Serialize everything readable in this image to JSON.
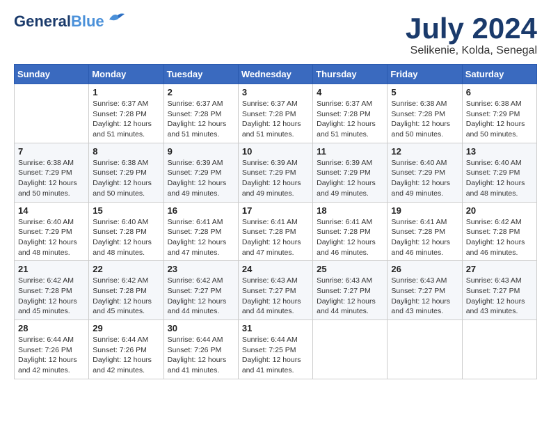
{
  "header": {
    "logo_line1": "General",
    "logo_line2": "Blue",
    "month_title": "July 2024",
    "location": "Selikenie, Kolda, Senegal"
  },
  "days_of_week": [
    "Sunday",
    "Monday",
    "Tuesday",
    "Wednesday",
    "Thursday",
    "Friday",
    "Saturday"
  ],
  "weeks": [
    [
      {
        "day": "",
        "sunrise": "",
        "sunset": "",
        "daylight": ""
      },
      {
        "day": "1",
        "sunrise": "Sunrise: 6:37 AM",
        "sunset": "Sunset: 7:28 PM",
        "daylight": "Daylight: 12 hours and 51 minutes."
      },
      {
        "day": "2",
        "sunrise": "Sunrise: 6:37 AM",
        "sunset": "Sunset: 7:28 PM",
        "daylight": "Daylight: 12 hours and 51 minutes."
      },
      {
        "day": "3",
        "sunrise": "Sunrise: 6:37 AM",
        "sunset": "Sunset: 7:28 PM",
        "daylight": "Daylight: 12 hours and 51 minutes."
      },
      {
        "day": "4",
        "sunrise": "Sunrise: 6:37 AM",
        "sunset": "Sunset: 7:28 PM",
        "daylight": "Daylight: 12 hours and 51 minutes."
      },
      {
        "day": "5",
        "sunrise": "Sunrise: 6:38 AM",
        "sunset": "Sunset: 7:28 PM",
        "daylight": "Daylight: 12 hours and 50 minutes."
      },
      {
        "day": "6",
        "sunrise": "Sunrise: 6:38 AM",
        "sunset": "Sunset: 7:29 PM",
        "daylight": "Daylight: 12 hours and 50 minutes."
      }
    ],
    [
      {
        "day": "7",
        "sunrise": "Sunrise: 6:38 AM",
        "sunset": "Sunset: 7:29 PM",
        "daylight": "Daylight: 12 hours and 50 minutes."
      },
      {
        "day": "8",
        "sunrise": "Sunrise: 6:38 AM",
        "sunset": "Sunset: 7:29 PM",
        "daylight": "Daylight: 12 hours and 50 minutes."
      },
      {
        "day": "9",
        "sunrise": "Sunrise: 6:39 AM",
        "sunset": "Sunset: 7:29 PM",
        "daylight": "Daylight: 12 hours and 49 minutes."
      },
      {
        "day": "10",
        "sunrise": "Sunrise: 6:39 AM",
        "sunset": "Sunset: 7:29 PM",
        "daylight": "Daylight: 12 hours and 49 minutes."
      },
      {
        "day": "11",
        "sunrise": "Sunrise: 6:39 AM",
        "sunset": "Sunset: 7:29 PM",
        "daylight": "Daylight: 12 hours and 49 minutes."
      },
      {
        "day": "12",
        "sunrise": "Sunrise: 6:40 AM",
        "sunset": "Sunset: 7:29 PM",
        "daylight": "Daylight: 12 hours and 49 minutes."
      },
      {
        "day": "13",
        "sunrise": "Sunrise: 6:40 AM",
        "sunset": "Sunset: 7:29 PM",
        "daylight": "Daylight: 12 hours and 48 minutes."
      }
    ],
    [
      {
        "day": "14",
        "sunrise": "Sunrise: 6:40 AM",
        "sunset": "Sunset: 7:29 PM",
        "daylight": "Daylight: 12 hours and 48 minutes."
      },
      {
        "day": "15",
        "sunrise": "Sunrise: 6:40 AM",
        "sunset": "Sunset: 7:28 PM",
        "daylight": "Daylight: 12 hours and 48 minutes."
      },
      {
        "day": "16",
        "sunrise": "Sunrise: 6:41 AM",
        "sunset": "Sunset: 7:28 PM",
        "daylight": "Daylight: 12 hours and 47 minutes."
      },
      {
        "day": "17",
        "sunrise": "Sunrise: 6:41 AM",
        "sunset": "Sunset: 7:28 PM",
        "daylight": "Daylight: 12 hours and 47 minutes."
      },
      {
        "day": "18",
        "sunrise": "Sunrise: 6:41 AM",
        "sunset": "Sunset: 7:28 PM",
        "daylight": "Daylight: 12 hours and 46 minutes."
      },
      {
        "day": "19",
        "sunrise": "Sunrise: 6:41 AM",
        "sunset": "Sunset: 7:28 PM",
        "daylight": "Daylight: 12 hours and 46 minutes."
      },
      {
        "day": "20",
        "sunrise": "Sunrise: 6:42 AM",
        "sunset": "Sunset: 7:28 PM",
        "daylight": "Daylight: 12 hours and 46 minutes."
      }
    ],
    [
      {
        "day": "21",
        "sunrise": "Sunrise: 6:42 AM",
        "sunset": "Sunset: 7:28 PM",
        "daylight": "Daylight: 12 hours and 45 minutes."
      },
      {
        "day": "22",
        "sunrise": "Sunrise: 6:42 AM",
        "sunset": "Sunset: 7:28 PM",
        "daylight": "Daylight: 12 hours and 45 minutes."
      },
      {
        "day": "23",
        "sunrise": "Sunrise: 6:42 AM",
        "sunset": "Sunset: 7:27 PM",
        "daylight": "Daylight: 12 hours and 44 minutes."
      },
      {
        "day": "24",
        "sunrise": "Sunrise: 6:43 AM",
        "sunset": "Sunset: 7:27 PM",
        "daylight": "Daylight: 12 hours and 44 minutes."
      },
      {
        "day": "25",
        "sunrise": "Sunrise: 6:43 AM",
        "sunset": "Sunset: 7:27 PM",
        "daylight": "Daylight: 12 hours and 44 minutes."
      },
      {
        "day": "26",
        "sunrise": "Sunrise: 6:43 AM",
        "sunset": "Sunset: 7:27 PM",
        "daylight": "Daylight: 12 hours and 43 minutes."
      },
      {
        "day": "27",
        "sunrise": "Sunrise: 6:43 AM",
        "sunset": "Sunset: 7:27 PM",
        "daylight": "Daylight: 12 hours and 43 minutes."
      }
    ],
    [
      {
        "day": "28",
        "sunrise": "Sunrise: 6:44 AM",
        "sunset": "Sunset: 7:26 PM",
        "daylight": "Daylight: 12 hours and 42 minutes."
      },
      {
        "day": "29",
        "sunrise": "Sunrise: 6:44 AM",
        "sunset": "Sunset: 7:26 PM",
        "daylight": "Daylight: 12 hours and 42 minutes."
      },
      {
        "day": "30",
        "sunrise": "Sunrise: 6:44 AM",
        "sunset": "Sunset: 7:26 PM",
        "daylight": "Daylight: 12 hours and 41 minutes."
      },
      {
        "day": "31",
        "sunrise": "Sunrise: 6:44 AM",
        "sunset": "Sunset: 7:25 PM",
        "daylight": "Daylight: 12 hours and 41 minutes."
      },
      {
        "day": "",
        "sunrise": "",
        "sunset": "",
        "daylight": ""
      },
      {
        "day": "",
        "sunrise": "",
        "sunset": "",
        "daylight": ""
      },
      {
        "day": "",
        "sunrise": "",
        "sunset": "",
        "daylight": ""
      }
    ]
  ]
}
